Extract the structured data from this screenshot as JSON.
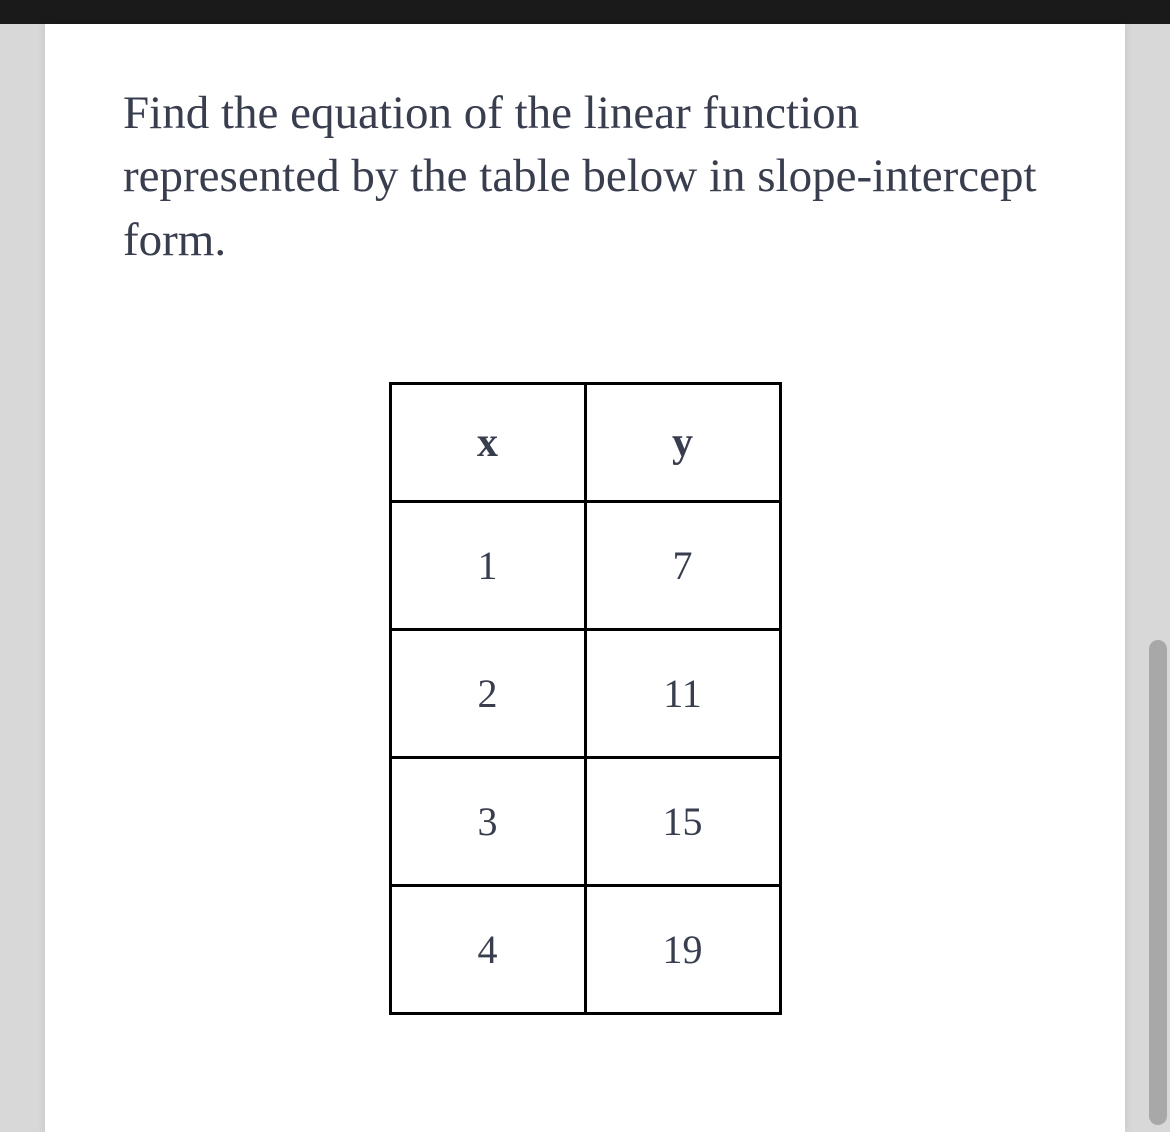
{
  "question": "Find the equation of the linear function represented by the table below in slope-intercept form.",
  "chart_data": {
    "type": "table",
    "headers": {
      "x": "x",
      "y": "y"
    },
    "rows": [
      {
        "x": "1",
        "y": "7"
      },
      {
        "x": "2",
        "y": "11"
      },
      {
        "x": "3",
        "y": "15"
      },
      {
        "x": "4",
        "y": "19"
      }
    ]
  }
}
